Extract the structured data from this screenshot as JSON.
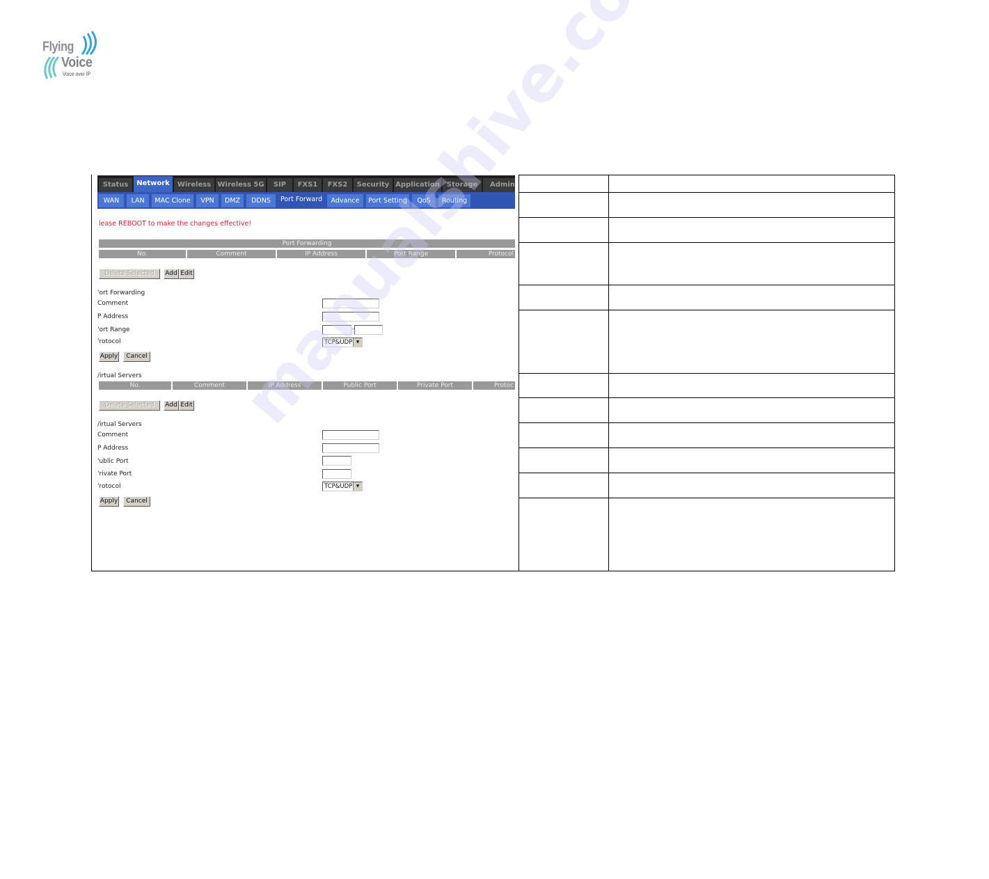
{
  "logo": {
    "line1": "Flying",
    "line2": "Voice",
    "tagline": "Voice over IP"
  },
  "top_tabs": [
    {
      "label": "Status",
      "active": false
    },
    {
      "label": "Network",
      "active": true
    },
    {
      "label": "Wireless",
      "active": false
    },
    {
      "label": "Wireless 5G",
      "active": false
    },
    {
      "label": "SIP",
      "active": false
    },
    {
      "label": "FXS1",
      "active": false
    },
    {
      "label": "FXS2",
      "active": false
    },
    {
      "label": "Security",
      "active": false
    },
    {
      "label": "Application",
      "active": false
    },
    {
      "label": "Storage",
      "active": false
    },
    {
      "label": "Adminis",
      "active": false
    }
  ],
  "sub_tabs": [
    {
      "label": "WAN",
      "active": false
    },
    {
      "label": "LAN",
      "active": false
    },
    {
      "label": "MAC Clone",
      "active": false
    },
    {
      "label": "VPN",
      "active": false
    },
    {
      "label": "DMZ",
      "active": false
    },
    {
      "label": "DDNS",
      "active": false
    },
    {
      "label": "Port Forward",
      "active": true
    },
    {
      "label": "Advance",
      "active": false
    },
    {
      "label": "Port Setting",
      "active": false
    },
    {
      "label": "QoS",
      "active": false
    },
    {
      "label": "Routing",
      "active": false
    }
  ],
  "warning": "lease REBOOT to make the changes effective!",
  "port_forwarding_table": {
    "title": "Port Forwarding",
    "columns": [
      "No.",
      "Comment",
      "IP Address",
      "Port Range",
      "Protocol"
    ],
    "rows": []
  },
  "port_forwarding_buttons": {
    "delete": "Delete Selected",
    "add": "Add",
    "edit": "Edit"
  },
  "port_forwarding_form": {
    "title": "'ort Forwarding",
    "comment_label": "Comment",
    "ip_label": "P Address",
    "port_range_label": "'ort Range",
    "protocol_label": "'rotocol",
    "comment_value": "",
    "ip_value": "",
    "port_start_value": "",
    "port_end_value": "",
    "range_separator": "-",
    "protocol_value": "TCP&UDP",
    "apply": "Apply",
    "cancel": "Cancel"
  },
  "virtual_servers_table": {
    "title": "/irtual Servers",
    "columns": [
      "No.",
      "Comment",
      "IP Address",
      "Public Port",
      "Private Port",
      "Protoc"
    ],
    "rows": []
  },
  "virtual_servers_buttons": {
    "delete": "Delete Selected",
    "add": "Add",
    "edit": "Edit"
  },
  "virtual_servers_form": {
    "title": "/irtual Servers",
    "comment_label": "Comment",
    "ip_label": "P Address",
    "public_port_label": "'ublic Port",
    "private_port_label": "'rivate Port",
    "protocol_label": "'rotocol",
    "comment_value": "",
    "ip_value": "",
    "public_port_value": "",
    "private_port_value": "",
    "protocol_value": "TCP&UDP",
    "apply": "Apply",
    "cancel": "Cancel"
  },
  "description_table": {
    "rows": [
      {
        "field": "",
        "description": ""
      },
      {
        "field": "",
        "description": ""
      },
      {
        "field": "",
        "description": ""
      },
      {
        "field": "",
        "description": ""
      },
      {
        "field": "",
        "description": ""
      },
      {
        "field": "",
        "description": ""
      },
      {
        "field": "",
        "description": ""
      },
      {
        "field": "",
        "description": ""
      },
      {
        "field": "",
        "description": ""
      },
      {
        "field": "",
        "description": ""
      },
      {
        "field": "",
        "description": ""
      },
      {
        "field": "",
        "description": ""
      }
    ]
  },
  "watermark": "manualshive.com",
  "colors": {
    "top_nav_bg": "#1c1c1c",
    "top_tab_bg": "#3a3a3a",
    "active_blue": "#3d66c2",
    "sub_nav_bg": "#2f57b3",
    "sub_tab_bg": "#4b78d6",
    "warning_red": "#cc2233",
    "table_header_gray": "#999999"
  }
}
